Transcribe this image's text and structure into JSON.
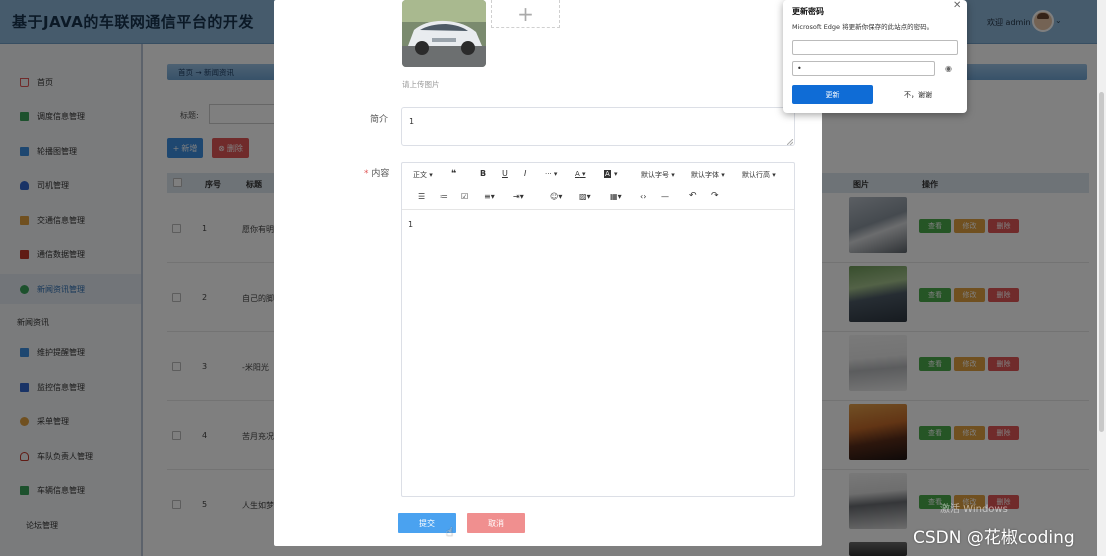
{
  "header": {
    "title": "基于JAVA的车联网通信平台的开发",
    "welcome": "欢迎 admin"
  },
  "sidebar": {
    "items": [
      {
        "label": "首页",
        "color": "#e05757"
      },
      {
        "label": "调度信息管理",
        "color": "#3aa35b"
      },
      {
        "label": "轮播图管理",
        "color": "#3d8fe0"
      },
      {
        "label": "司机管理",
        "color": "#3366cc"
      },
      {
        "label": "交通信息管理",
        "color": "#e0a040"
      },
      {
        "label": "通信数据管理",
        "color": "#c0392b"
      },
      {
        "label": "新闻资讯管理",
        "color": "#3aa35b"
      }
    ],
    "sub_label": "新闻资讯",
    "items2": [
      {
        "label": "维护提醒管理",
        "color": "#3d8fe0"
      },
      {
        "label": "监控信息管理",
        "color": "#3366cc"
      },
      {
        "label": "采单管理",
        "color": "#e0a040"
      },
      {
        "label": "车队负责人管理",
        "color": "#c0392b"
      },
      {
        "label": "车辆信息管理",
        "color": "#3aa35b"
      },
      {
        "label": "论坛管理",
        "color": ""
      }
    ]
  },
  "main": {
    "breadcrumb": "首页 → 新闻资讯",
    "filter_label": "标题:",
    "add_label": "新增",
    "delete_label": "删除",
    "table": {
      "headers": {
        "index": "序号",
        "title": "标题",
        "image": "图片",
        "ops": "操作"
      },
      "rows": [
        {
          "index": "1",
          "title": "愿你有明"
        },
        {
          "index": "2",
          "title": "自己的脚"
        },
        {
          "index": "3",
          "title": "-米阳光"
        },
        {
          "index": "4",
          "title": "苦月充况"
        },
        {
          "index": "5",
          "title": "人生如梦"
        }
      ],
      "view_label": "查看",
      "edit_label": "修改",
      "delete_label": "删除"
    }
  },
  "dialog": {
    "upload_hint": "请上传图片",
    "plus": "+",
    "intro_label": "简介",
    "intro_value": "1",
    "content_required": "*",
    "content_label": "内容",
    "toolbar": {
      "paragraph": "正文",
      "quote": "❝",
      "bold": "B",
      "underline": "U",
      "italic": "I",
      "more": "···",
      "font_color": "A",
      "bg_color": "A",
      "font_size": "默认字号",
      "font_family": "默认字体",
      "line_height": "默认行高",
      "ul": "☰",
      "ol": "≔",
      "todo": "☑",
      "align": "≡",
      "indent": "⇥",
      "emoji": "☺",
      "image": "▨",
      "table": "▦",
      "code": "‹›",
      "hr": "—",
      "undo": "↶",
      "redo": "↷"
    },
    "content_value": "1",
    "submit": "提交",
    "cancel": "取消"
  },
  "password_popup": {
    "title": "更新密码",
    "description": "Microsoft Edge 将更新你保存的此站点的密码。",
    "password_mask": "•",
    "update": "更新",
    "no_thanks": "不，谢谢",
    "close": "✕"
  },
  "watermark": "CSDN @花椒coding",
  "activation": "激活 Windows"
}
